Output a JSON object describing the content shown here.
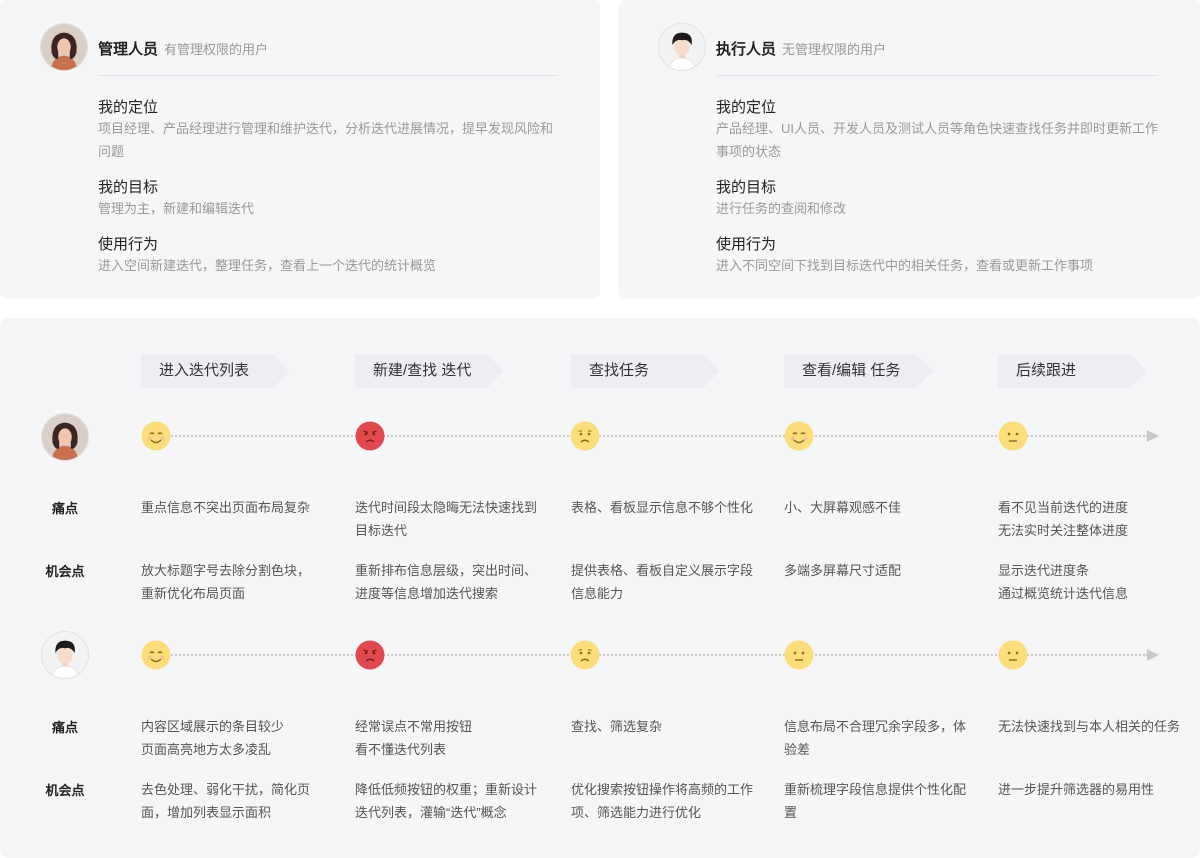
{
  "personas": [
    {
      "name": "管理人员",
      "subtitle": "有管理权限的用户",
      "sections": [
        {
          "title": "我的定位",
          "text": "项目经理、产品经理进行管理和维护迭代，分析迭代进展情况，提早发现风险和问题"
        },
        {
          "title": "我的目标",
          "text": "管理为主，新建和编辑迭代"
        },
        {
          "title": "使用行为",
          "text": "进入空间新建迭代，整理任务，查看上一个迭代的统计概览"
        }
      ]
    },
    {
      "name": "执行人员",
      "subtitle": "无管理权限的用户",
      "sections": [
        {
          "title": "我的定位",
          "text": "产品经理、UI人员、开发人员及测试人员等角色快速查找任务并即时更新工作事项的状态"
        },
        {
          "title": "我的目标",
          "text": "进行任务的查阅和修改"
        },
        {
          "title": "使用行为",
          "text": "进入不同空间下找到目标迭代中的相关任务，查看或更新工作事项"
        }
      ]
    }
  ],
  "journey": {
    "stages": [
      "进入迭代列表",
      "新建/查找 迭代",
      "查找任务",
      "查看/编辑 任务",
      "后续跟进"
    ],
    "pain_label": "痛点",
    "opportunity_label": "机会点",
    "lanes": [
      {
        "emotions": [
          "happy",
          "angry",
          "sad",
          "happy",
          "neutral"
        ],
        "pain_points": [
          "重点信息不突出页面布局复杂",
          "迭代时间段太隐晦无法快速找到目标迭代",
          "表格、看板显示信息不够个性化",
          "小、大屏幕观感不佳",
          "看不见当前迭代的进度\n无法实时关注整体进度"
        ],
        "opportunities": [
          "放大标题字号去除分割色块，\n重新优化布局页面",
          "重新排布信息层级，突出时间、进度等信息增加迭代搜索",
          "提供表格、看板自定义展示字段信息能力",
          "多端多屏幕尺寸适配",
          "显示迭代进度条\n通过概览统计迭代信息"
        ]
      },
      {
        "emotions": [
          "happy",
          "angry",
          "sad",
          "neutral",
          "neutral"
        ],
        "pain_points": [
          "内容区域展示的条目较少\n页面高亮地方太多凌乱",
          "经常误点不常用按钮\n看不懂迭代列表",
          "查找、筛选复杂",
          "信息布局不合理冗余字段多，体验差",
          "无法快速找到与本人相关的任务"
        ],
        "opportunities": [
          "去色处理、弱化干扰，简化页面，增加列表显示面积",
          "降低低频按钮的权重；重新设计迭代列表，灌输“迭代”概念",
          "优化搜索按钮操作将高频的工作项、筛选能力进行优化",
          "重新梳理字段信息提供个性化配置",
          "进一步提升筛选器的易用性"
        ]
      }
    ]
  },
  "colors": {
    "card_bg": "#f5f6f8",
    "stage_bg": "#eceef3",
    "face_yellow": "#fbdd7a",
    "face_red": "#e04a4f",
    "timeline": "#c8c8c8"
  }
}
